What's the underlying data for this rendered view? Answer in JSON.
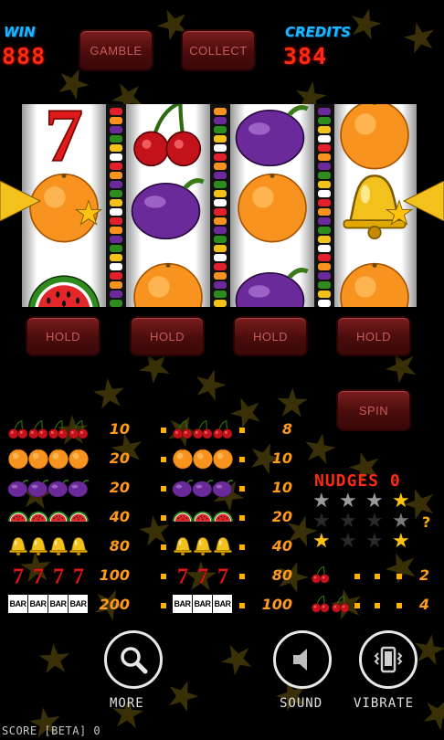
{
  "header": {
    "win_label": "WIN",
    "win_value": "888",
    "credits_label": "CREDITS",
    "credits_value": "384",
    "gamble_label": "GAMBLE",
    "collect_label": "COLLECT"
  },
  "reels": [
    {
      "symbols": [
        "seven",
        "orange",
        "watermelon"
      ],
      "star_on": "orange"
    },
    {
      "symbols": [
        "cherries",
        "plum",
        "orange"
      ],
      "star_on": null
    },
    {
      "symbols": [
        "plum",
        "orange",
        "plum"
      ],
      "star_on": null
    },
    {
      "symbols": [
        "orange",
        "bell",
        "orange"
      ],
      "star_on": "bell"
    }
  ],
  "hold_buttons": [
    "HOLD",
    "HOLD",
    "HOLD",
    "HOLD"
  ],
  "spin_label": "SPIN",
  "paytable": {
    "left": [
      {
        "symbol": "cherries",
        "count": 4,
        "value": "10"
      },
      {
        "symbol": "orange",
        "count": 4,
        "value": "20"
      },
      {
        "symbol": "plum",
        "count": 4,
        "value": "20"
      },
      {
        "symbol": "watermelon",
        "count": 4,
        "value": "40"
      },
      {
        "symbol": "bell",
        "count": 4,
        "value": "80"
      },
      {
        "symbol": "seven",
        "count": 4,
        "value": "100"
      },
      {
        "symbol": "bar",
        "count": 4,
        "value": "200"
      }
    ],
    "right": [
      {
        "symbol": "cherries",
        "count": 3,
        "value": "8"
      },
      {
        "symbol": "orange",
        "count": 3,
        "value": "10"
      },
      {
        "symbol": "plum",
        "count": 3,
        "value": "10"
      },
      {
        "symbol": "watermelon",
        "count": 3,
        "value": "20"
      },
      {
        "symbol": "bell",
        "count": 3,
        "value": "40"
      },
      {
        "symbol": "seven",
        "count": 3,
        "value": "80"
      },
      {
        "symbol": "bar",
        "count": 3,
        "value": "100"
      }
    ],
    "cherry_pays": [
      {
        "count": 1,
        "value": "2"
      },
      {
        "count": 2,
        "value": "4"
      }
    ]
  },
  "nudges": {
    "label": "NUDGES",
    "value": "0",
    "mystery": "?"
  },
  "buttons": {
    "more_label": "MORE",
    "sound_label": "SOUND",
    "vibrate_label": "VIBRATE"
  },
  "footer": {
    "score_text": "SCORE [BETA] 0"
  },
  "colors": {
    "digit_red": "#ff2a10",
    "label_blue": "#19b8ff",
    "pay_orange": "#ff9a1a",
    "button_red": "#5a1212"
  }
}
